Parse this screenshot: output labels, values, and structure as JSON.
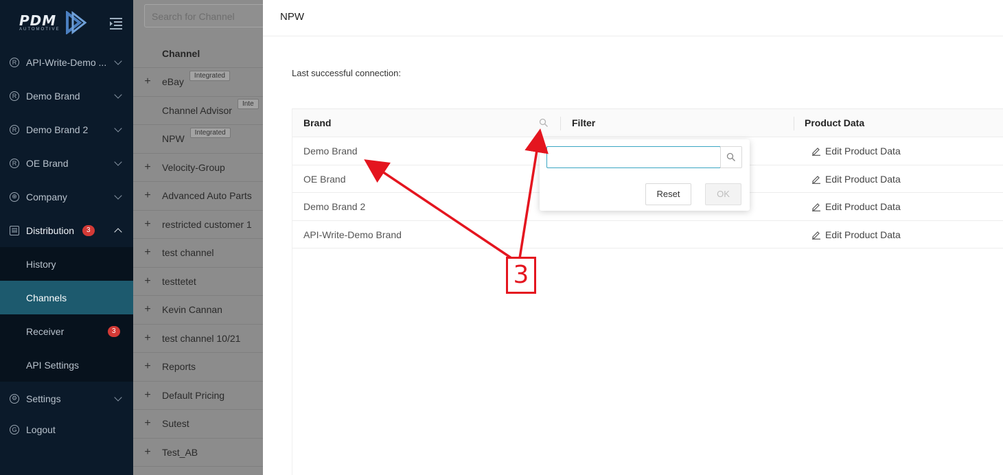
{
  "sidebar": {
    "logo_text": "PDM",
    "logo_sub": "AUTOMOTIVE",
    "items": [
      {
        "label": "API-Write-Demo ...",
        "icon": "registered-icon"
      },
      {
        "label": "Demo Brand",
        "icon": "registered-icon"
      },
      {
        "label": "Demo Brand 2",
        "icon": "registered-icon"
      },
      {
        "label": "OE Brand",
        "icon": "registered-icon"
      },
      {
        "label": "Company",
        "icon": "globe-icon"
      },
      {
        "label": "Distribution",
        "icon": "distribution-icon",
        "badge": "3"
      },
      {
        "label": "Settings",
        "icon": "gear-icon"
      },
      {
        "label": "Logout",
        "icon": "logout-icon"
      }
    ],
    "sub_items": [
      {
        "label": "History"
      },
      {
        "label": "Channels",
        "selected": true
      },
      {
        "label": "Receiver",
        "badge": "3"
      },
      {
        "label": "API Settings"
      }
    ]
  },
  "channels": {
    "search_placeholder": "Search for Channel",
    "header": "Channel",
    "rows": [
      {
        "name": "eBay",
        "tag": "Integrated",
        "expand": "+"
      },
      {
        "name": "Channel Advisor",
        "tag": "Inte",
        "expand": ""
      },
      {
        "name": "NPW",
        "tag": "Integrated",
        "expand": ""
      },
      {
        "name": "Velocity-Group",
        "tag": "",
        "expand": "+"
      },
      {
        "name": "Advanced Auto Parts",
        "tag": "",
        "expand": "+"
      },
      {
        "name": "restricted customer 1",
        "tag": "",
        "expand": "+"
      },
      {
        "name": "test channel",
        "tag": "",
        "expand": "+"
      },
      {
        "name": "testtetet",
        "tag": "",
        "expand": "+"
      },
      {
        "name": "Kevin Cannan",
        "tag": "",
        "expand": "+"
      },
      {
        "name": "test channel 10/21",
        "tag": "",
        "expand": "+"
      },
      {
        "name": "Reports",
        "tag": "",
        "expand": "+"
      },
      {
        "name": "Default Pricing",
        "tag": "",
        "expand": "+"
      },
      {
        "name": "Sutest",
        "tag": "",
        "expand": "+"
      },
      {
        "name": "Test_AB",
        "tag": "",
        "expand": "+"
      }
    ]
  },
  "drawer": {
    "title": "NPW",
    "last_connection_label": "Last successful connection:",
    "columns": {
      "brand": "Brand",
      "filter": "Filter",
      "product_data": "Product Data"
    },
    "rows": [
      {
        "brand": "Demo Brand",
        "action": "Edit Product Data"
      },
      {
        "brand": "OE Brand",
        "action": "Edit Product Data"
      },
      {
        "brand": "Demo Brand 2",
        "action": "Edit Product Data"
      },
      {
        "brand": "API-Write-Demo Brand",
        "action": "Edit Product Data"
      }
    ]
  },
  "filter_popup": {
    "input_value": "",
    "reset_label": "Reset",
    "ok_label": "OK"
  },
  "annotation": {
    "label": "3",
    "color": "#e4151f"
  }
}
